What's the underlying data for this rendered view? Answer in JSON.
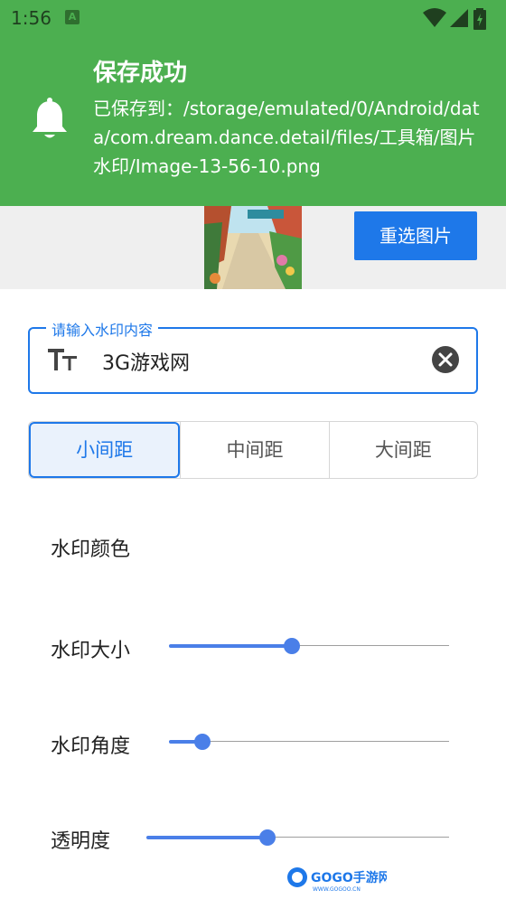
{
  "status_bar": {
    "time": "1:56"
  },
  "notification": {
    "title": "保存成功",
    "body": "已保存到：/storage/emulated/0/Android/data/com.dream.dance.detail/files/工具箱/图片水印/Image-13-56-10.png",
    "accent": "#4caf50"
  },
  "strip": {
    "reselect_label": "重选图片"
  },
  "input": {
    "label": "请输入水印内容",
    "value": "3G游戏网"
  },
  "spacing": {
    "options": [
      "小间距",
      "中间距",
      "大间距"
    ],
    "selected": "小间距"
  },
  "settings": {
    "color_label": "水印颜色",
    "size_label": "水印大小",
    "size_value": 0.44,
    "angle_label": "水印角度",
    "angle_value": 0.12,
    "opacity_label": "透明度",
    "opacity_value": 0.4
  },
  "accent_color": "#1e78e9",
  "watermark": {
    "brand": "GOGO手游网",
    "url": "WWW.GOGOO.CN"
  }
}
